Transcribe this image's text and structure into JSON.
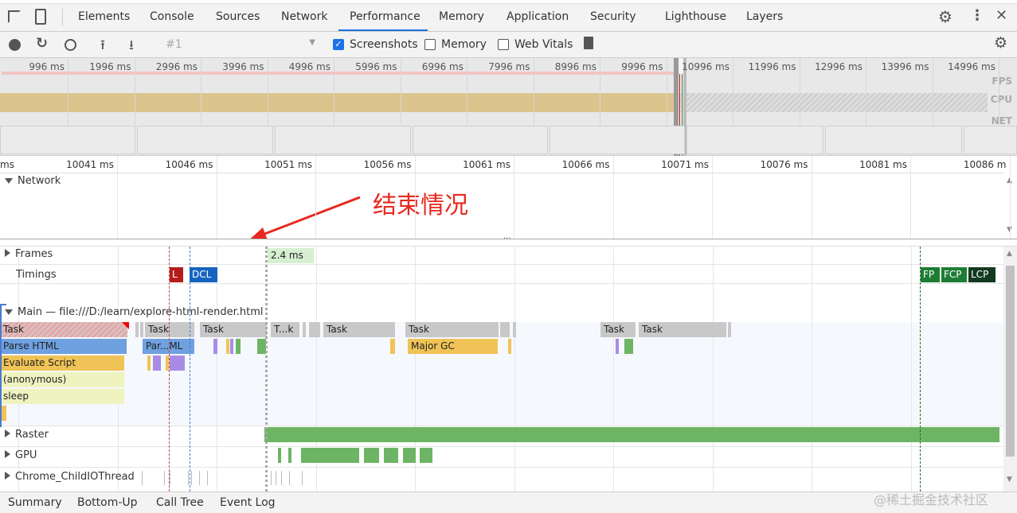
{
  "tabs": [
    "Elements",
    "Console",
    "Sources",
    "Network",
    "Performance",
    "Memory",
    "Application",
    "Security",
    "Lighthouse",
    "Layers"
  ],
  "active_tab": "Performance",
  "toolbar": {
    "recording": "#1",
    "screenshots": "Screenshots",
    "memory": "Memory",
    "web_vitals": "Web Vitals",
    "screenshots_checked": true,
    "memory_checked": false,
    "web_vitals_checked": false
  },
  "overview": {
    "ticks": [
      "996 ms",
      "1996 ms",
      "2996 ms",
      "3996 ms",
      "4996 ms",
      "5996 ms",
      "6996 ms",
      "7996 ms",
      "8996 ms",
      "9996 ms",
      "10996 ms",
      "11996 ms",
      "12996 ms",
      "13996 ms",
      "14996 ms"
    ],
    "fps": "FPS",
    "cpu": "CPU",
    "net": "NET"
  },
  "ruler": {
    "first": "ms",
    "ticks": [
      "10041 ms",
      "10046 ms",
      "10051 ms",
      "10056 ms",
      "10061 ms",
      "10066 ms",
      "10071 ms",
      "10076 ms",
      "10081 ms",
      "10086 m"
    ]
  },
  "tracks": {
    "network": "Network",
    "frames": "Frames",
    "frame_time": "2.4 ms",
    "timings": "Timings",
    "main": "Main — file:///D:/learn/explore-html-render.html",
    "raster": "Raster",
    "gpu": "GPU",
    "io": "Chrome_ChildIOThread"
  },
  "markers": {
    "l": "L",
    "dcl": "DCL",
    "fp": "FP",
    "fcp": "FCP",
    "lcp": "LCP"
  },
  "flame": {
    "task": "Task",
    "task_short": "T...k",
    "parse_html": "Parse HTML",
    "parse_short": "Par...ML",
    "evaluate_script": "Evaluate Script",
    "anonymous": "(anonymous)",
    "sleep": "sleep",
    "major_gc": "Major GC"
  },
  "annotation": "结束情况",
  "bottom_tabs": [
    "Summary",
    "Bottom-Up",
    "Call Tree",
    "Event Log"
  ],
  "watermark": "@稀土掘金技术社区",
  "colors": {
    "accent": "#1a73e8",
    "annotation": "#e8281e",
    "task": "#c8c8c8",
    "parse": "#6fa0e0",
    "script": "#f0c356",
    "anon": "#eef3c0",
    "gc": "#f0c356",
    "paint": "#6db465",
    "lmark": "#b71c1c",
    "dcl": "#1565c0",
    "fp": "#1e7d34",
    "lcp": "#123a20"
  }
}
